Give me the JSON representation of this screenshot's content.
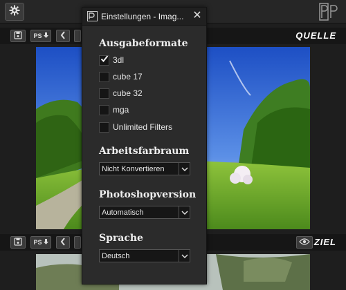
{
  "window": {
    "settings_icon": "gear-icon",
    "logo_icon": "p-logo-icon"
  },
  "source_panel": {
    "label": "QUELLE",
    "toolbar": [
      {
        "name": "save-icon"
      },
      {
        "name": "ps-import",
        "label": "PS"
      },
      {
        "name": "chevron-left-icon"
      }
    ]
  },
  "target_panel": {
    "label": "ZIEL",
    "eye_icon": "eye-icon",
    "toolbar": [
      {
        "name": "save-icon"
      },
      {
        "name": "ps-import",
        "label": "PS"
      },
      {
        "name": "chevron-left-icon"
      }
    ]
  },
  "dialog": {
    "title": "Einstellungen - Imag...",
    "close_icon": "close-icon",
    "output_formats": {
      "heading": "Ausgabeformate",
      "items": [
        {
          "label": "3dl",
          "checked": true
        },
        {
          "label": "cube 17",
          "checked": false
        },
        {
          "label": "cube 32",
          "checked": false
        },
        {
          "label": "mga",
          "checked": false
        },
        {
          "label": "Unlimited Filters",
          "checked": false
        }
      ]
    },
    "color_space": {
      "heading": "Arbeitsfarbraum",
      "selected": "Nicht Konvertieren"
    },
    "photoshop_version": {
      "heading": "Photoshopversion",
      "selected": "Automatisch"
    },
    "language": {
      "heading": "Sprache",
      "selected": "Deutsch"
    }
  },
  "colors": {
    "dialog_bg": "#2b2b2b",
    "panel_bar": "#161616",
    "checkbox_bg": "#151515"
  }
}
